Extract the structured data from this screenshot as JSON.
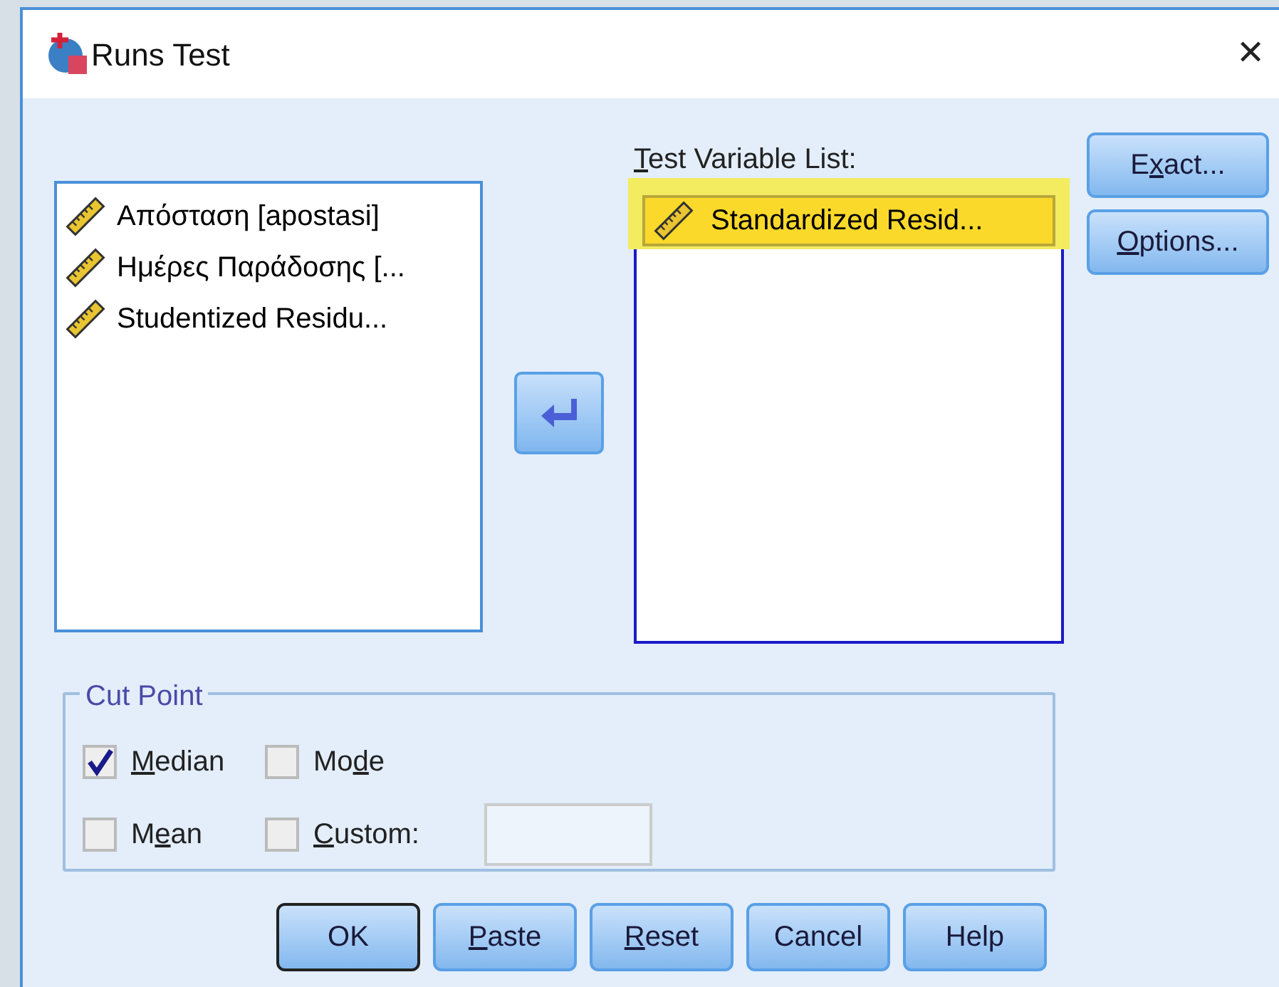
{
  "window": {
    "title": "Runs Test",
    "close": "✕"
  },
  "source_list": {
    "items": [
      {
        "label": "Απόσταση [apostasi]",
        "selected": false
      },
      {
        "label": "Ημέρες Παράδοσης [...",
        "selected": false
      },
      {
        "label": "Studentized Residu...",
        "selected": false
      }
    ]
  },
  "test_variable_list": {
    "label": {
      "key": "T",
      "post": "est Variable List:"
    },
    "items": [
      {
        "label": "Standardized Resid...",
        "selected": true
      }
    ]
  },
  "side_buttons": [
    {
      "label": {
        "pre": "E",
        "key": "x",
        "post": "act..."
      }
    },
    {
      "label": {
        "key": "O",
        "post": "ptions..."
      }
    }
  ],
  "cut_point": {
    "title": "Cut Point",
    "options": [
      {
        "label": {
          "key": "M",
          "post": "edian"
        },
        "checked": true
      },
      {
        "label": {
          "pre": "Mo",
          "key": "d",
          "post": "e"
        },
        "checked": false
      },
      {
        "label": {
          "pre": "M",
          "key": "e",
          "post": "an"
        },
        "checked": false
      },
      {
        "label": {
          "key": "C",
          "post": "ustom:"
        },
        "checked": false
      }
    ],
    "custom_value": {
      "disabled": true
    }
  },
  "buttons": [
    {
      "label": {
        "pre": "OK"
      },
      "default": true
    },
    {
      "label": {
        "key": "P",
        "post": "aste"
      },
      "default": false
    },
    {
      "label": {
        "key": "R",
        "post": "eset"
      },
      "default": false
    },
    {
      "label": {
        "pre": "Cancel"
      },
      "default": false
    },
    {
      "label": {
        "pre": "Help"
      },
      "default": false
    }
  ]
}
